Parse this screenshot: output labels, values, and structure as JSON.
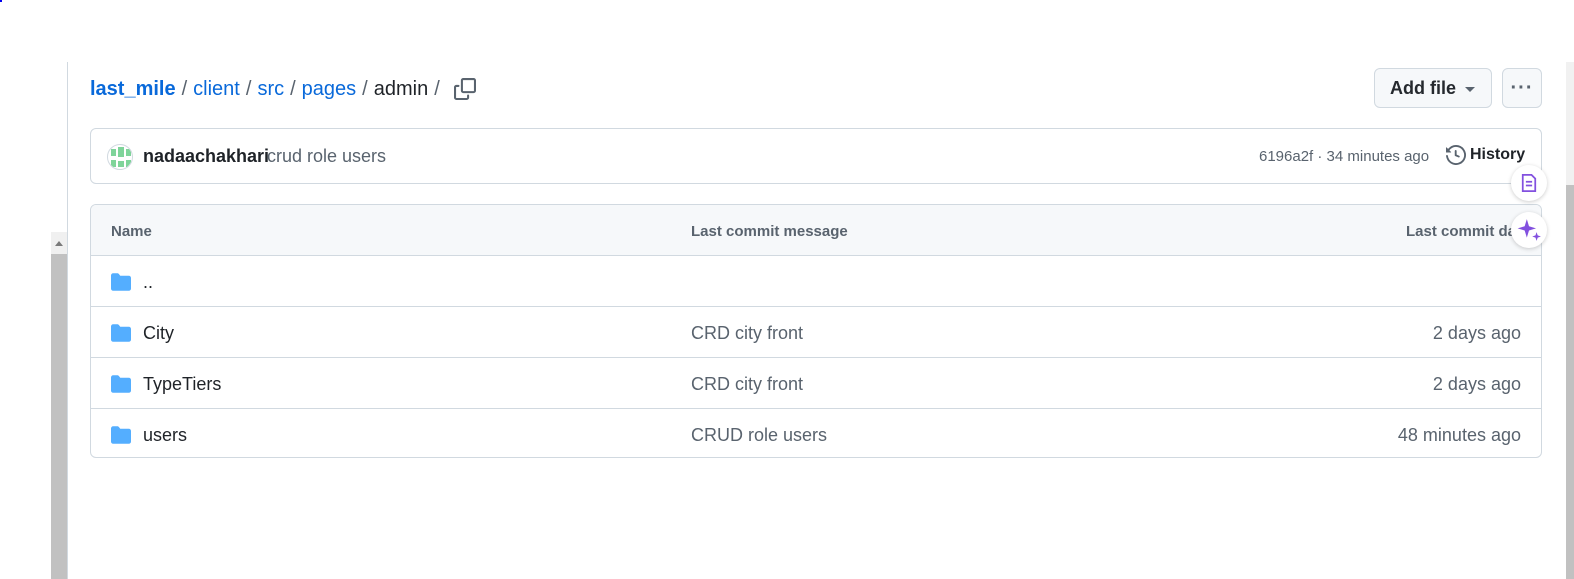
{
  "breadcrumb": {
    "repo": "last_mile",
    "parts": [
      "client",
      "src",
      "pages"
    ],
    "current": "admin",
    "separator": "/"
  },
  "toolbar": {
    "add_file_label": "Add file",
    "more_label": "···"
  },
  "commit": {
    "author": "nadaachakhari",
    "message": "crud role users",
    "meta": "6196a2f · 34 minutes ago",
    "history_label": "History"
  },
  "table": {
    "headers": {
      "name": "Name",
      "message": "Last commit message",
      "date": "Last commit dat"
    },
    "parent": "..",
    "rows": [
      {
        "name": "City",
        "message": "CRD city front",
        "date": "2 days ago"
      },
      {
        "name": "TypeTiers",
        "message": "CRD city front",
        "date": "2 days ago"
      },
      {
        "name": "users",
        "message": "CRUD role users",
        "date": "48 minutes ago"
      }
    ]
  },
  "colors": {
    "link": "#0969da",
    "folder": "#54aeff",
    "accent_purple": "#8250df"
  },
  "icons": {
    "copy": "copy-icon",
    "history": "history-icon",
    "folder": "folder-icon",
    "file_summary": "file-summary-icon",
    "copilot": "sparkle-icon"
  }
}
